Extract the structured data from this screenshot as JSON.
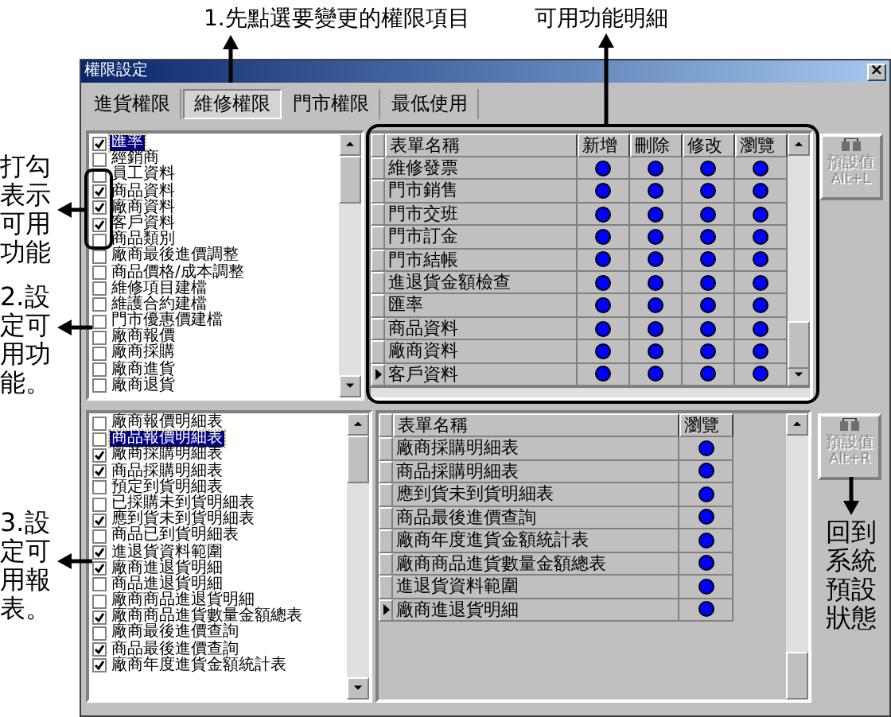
{
  "annotations": {
    "step1": "1.先點選要變更的權限項目",
    "details": "可用功能明細",
    "check_hint": "打勾表示可用功能",
    "step2": "2.設定可用功能。",
    "step3": "3.設定可用報表。",
    "reset_hint": "回到系統預設狀態"
  },
  "window": {
    "title": "權限設定",
    "close": "×"
  },
  "tabs": [
    {
      "label": "進貨權限",
      "selected": false
    },
    {
      "label": "維修權限",
      "selected": true
    },
    {
      "label": "門市權限",
      "selected": false
    },
    {
      "label": "最低使用",
      "selected": false
    }
  ],
  "function_list": {
    "items": [
      {
        "label": "匯率",
        "checked": true,
        "selected": true
      },
      {
        "label": "經銷商",
        "checked": false,
        "selected": false
      },
      {
        "label": "員工資料",
        "checked": false,
        "selected": false
      },
      {
        "label": "商品資料",
        "checked": true,
        "selected": false
      },
      {
        "label": "廠商資料",
        "checked": true,
        "selected": false
      },
      {
        "label": "客戶資料",
        "checked": true,
        "selected": false
      },
      {
        "label": "商品類別",
        "checked": false,
        "selected": false
      },
      {
        "label": "廠商最後進價調整",
        "checked": false,
        "selected": false
      },
      {
        "label": "商品價格/成本調整",
        "checked": false,
        "selected": false
      },
      {
        "label": "維修項目建檔",
        "checked": false,
        "selected": false
      },
      {
        "label": "維護合約建檔",
        "checked": false,
        "selected": false
      },
      {
        "label": "門市優惠價建檔",
        "checked": false,
        "selected": false
      },
      {
        "label": "廠商報價",
        "checked": false,
        "selected": false
      },
      {
        "label": "廠商採購",
        "checked": false,
        "selected": false
      },
      {
        "label": "廠商進貨",
        "checked": false,
        "selected": false
      },
      {
        "label": "廠商退貨",
        "checked": false,
        "selected": false
      }
    ]
  },
  "function_grid": {
    "columns": [
      "表單名稱",
      "新增",
      "刪除",
      "修改",
      "瀏覽"
    ],
    "rows": [
      {
        "name": "維修發票",
        "current": false,
        "permissions": [
          {
            "on": true
          },
          {
            "on": true
          },
          {
            "on": true
          },
          {
            "on": true
          }
        ]
      },
      {
        "name": "門市銷售",
        "current": false,
        "permissions": [
          {
            "on": true
          },
          {
            "on": true
          },
          {
            "on": true
          },
          {
            "on": true
          }
        ]
      },
      {
        "name": "門市交班",
        "current": false,
        "permissions": [
          {
            "on": true
          },
          {
            "on": true
          },
          {
            "on": true
          },
          {
            "on": true
          }
        ]
      },
      {
        "name": "門市訂金",
        "current": false,
        "permissions": [
          {
            "on": true
          },
          {
            "on": true
          },
          {
            "on": true
          },
          {
            "on": true
          }
        ]
      },
      {
        "name": "門市結帳",
        "current": false,
        "permissions": [
          {
            "on": true
          },
          {
            "on": true
          },
          {
            "on": true
          },
          {
            "on": true
          }
        ]
      },
      {
        "name": "進退貨金額檢查",
        "current": false,
        "permissions": [
          {
            "on": true
          },
          {
            "on": true
          },
          {
            "on": true
          },
          {
            "on": true
          }
        ]
      },
      {
        "name": "匯率",
        "current": false,
        "permissions": [
          {
            "on": true
          },
          {
            "on": true
          },
          {
            "on": true
          },
          {
            "on": true
          }
        ]
      },
      {
        "name": "商品資料",
        "current": false,
        "permissions": [
          {
            "on": true
          },
          {
            "on": true
          },
          {
            "on": true
          },
          {
            "on": true
          }
        ]
      },
      {
        "name": "廠商資料",
        "current": false,
        "permissions": [
          {
            "on": true
          },
          {
            "on": true
          },
          {
            "on": true
          },
          {
            "on": true
          }
        ]
      },
      {
        "name": "客戶資料",
        "current": true,
        "permissions": [
          {
            "on": true
          },
          {
            "on": true
          },
          {
            "on": true
          },
          {
            "on": true
          }
        ]
      }
    ]
  },
  "function_default_button": {
    "label": "預設值",
    "shortcut": "Alt+L",
    "disabled": true
  },
  "report_list": {
    "items": [
      {
        "label": "廠商報價明細表",
        "checked": false,
        "selected": false
      },
      {
        "label": "商品報價明細表",
        "checked": false,
        "selected": true
      },
      {
        "label": "廠商採購明細表",
        "checked": true,
        "selected": false
      },
      {
        "label": "商品採購明細表",
        "checked": true,
        "selected": false
      },
      {
        "label": "預定到貨明細表",
        "checked": false,
        "selected": false
      },
      {
        "label": "已採購未到貨明細表",
        "checked": false,
        "selected": false
      },
      {
        "label": "應到貨未到貨明細表",
        "checked": true,
        "selected": false
      },
      {
        "label": "商品已到貨明細表",
        "checked": false,
        "selected": false
      },
      {
        "label": "進退貨資料範圍",
        "checked": true,
        "selected": false
      },
      {
        "label": "廠商進退貨明細",
        "checked": true,
        "selected": false
      },
      {
        "label": "商品進退貨明細",
        "checked": false,
        "selected": false
      },
      {
        "label": "廠商商品進退貨明細",
        "checked": false,
        "selected": false
      },
      {
        "label": "廠商商品進貨數量金額總表",
        "checked": true,
        "selected": false
      },
      {
        "label": "廠商最後進價查詢",
        "checked": false,
        "selected": false
      },
      {
        "label": "商品最後進價查詢",
        "checked": true,
        "selected": false
      },
      {
        "label": "廠商年度進貨金額統計表",
        "checked": true,
        "selected": false
      }
    ]
  },
  "report_grid": {
    "columns": [
      "表單名稱",
      "瀏覽"
    ],
    "rows": [
      {
        "name": "廠商採購明細表",
        "current": false,
        "permissions": [
          {
            "on": true
          }
        ]
      },
      {
        "name": "商品採購明細表",
        "current": false,
        "permissions": [
          {
            "on": true
          }
        ]
      },
      {
        "name": "應到貨未到貨明細表",
        "current": false,
        "permissions": [
          {
            "on": true
          }
        ]
      },
      {
        "name": "商品最後進價查詢",
        "current": false,
        "permissions": [
          {
            "on": true
          }
        ]
      },
      {
        "name": "廠商年度進貨金額統計表",
        "current": false,
        "permissions": [
          {
            "on": true
          }
        ]
      },
      {
        "name": "廠商商品進貨數量金額總表",
        "current": false,
        "permissions": [
          {
            "on": true
          }
        ]
      },
      {
        "name": "進退貨資料範圍",
        "current": false,
        "permissions": [
          {
            "on": true
          }
        ]
      },
      {
        "name": "廠商進退貨明細",
        "current": true,
        "permissions": [
          {
            "on": true
          }
        ]
      }
    ]
  },
  "report_default_button": {
    "label": "預設值",
    "shortcut": "Alt+R",
    "disabled": true
  }
}
